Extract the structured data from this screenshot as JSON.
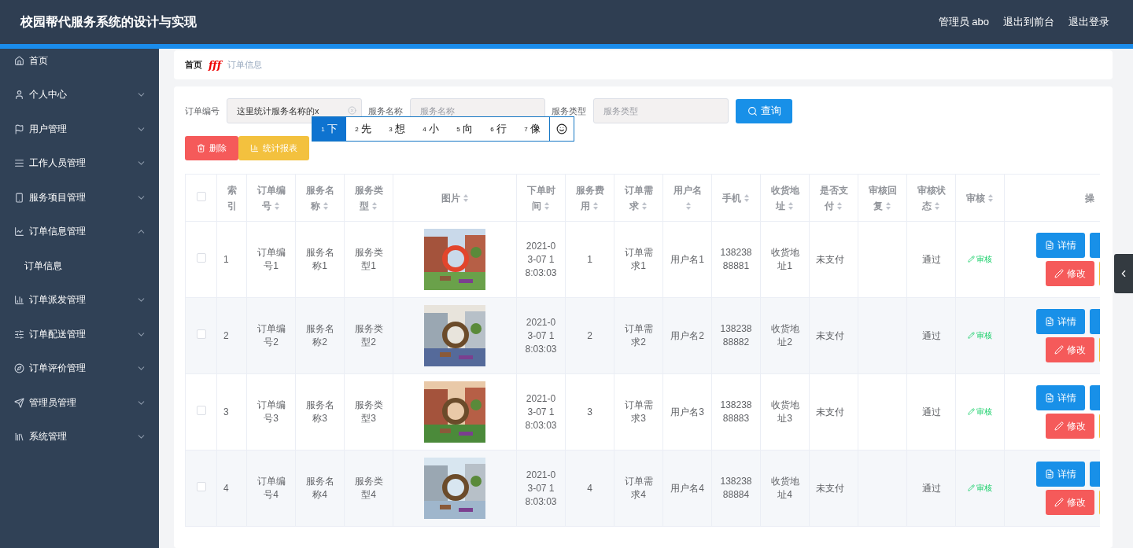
{
  "header": {
    "title": "校园帮代服务系统的设计与实现",
    "user": "管理员 abo",
    "links": [
      "退出到前台",
      "退出登录"
    ]
  },
  "sidebar": {
    "items": [
      {
        "label": "首页"
      },
      {
        "label": "个人中心",
        "expanded": false
      },
      {
        "label": "用户管理",
        "expanded": false
      },
      {
        "label": "工作人员管理",
        "expanded": false
      },
      {
        "label": "服务项目管理",
        "expanded": false
      },
      {
        "label": "订单信息管理",
        "expanded": true,
        "children": [
          {
            "label": "订单信息",
            "selected": true
          }
        ]
      },
      {
        "label": "订单派发管理",
        "expanded": false
      },
      {
        "label": "订单配送管理",
        "expanded": false
      },
      {
        "label": "订单评价管理",
        "expanded": false
      },
      {
        "label": "管理员管理",
        "expanded": false
      },
      {
        "label": "系统管理",
        "expanded": false
      }
    ]
  },
  "breadcrumb": {
    "home": "首页",
    "separator": "fff",
    "current": "订单信息"
  },
  "filters": [
    {
      "label": "订单编号",
      "value": "这里统计服务名称的x"
    },
    {
      "label": "服务名称",
      "placeholder": "服务名称"
    },
    {
      "label": "服务类型",
      "placeholder": "服务类型"
    }
  ],
  "search_button": "查询",
  "actions": [
    {
      "label": "删除",
      "kind": "danger"
    },
    {
      "label": "统计报表",
      "kind": "warning"
    }
  ],
  "ime": {
    "candidates": [
      {
        "number": "1",
        "char": "下",
        "selected": true
      },
      {
        "number": "2",
        "char": "先",
        "selected": false
      },
      {
        "number": "3",
        "char": "想",
        "selected": false
      },
      {
        "number": "4",
        "char": "小",
        "selected": false
      },
      {
        "number": "5",
        "char": "向",
        "selected": false
      },
      {
        "number": "6",
        "char": "行",
        "selected": false
      },
      {
        "number": "7",
        "char": "像",
        "selected": false
      }
    ]
  },
  "table": {
    "all_checked": false,
    "columns": [
      {
        "label": "索引",
        "kind": "text",
        "sortable": false
      },
      {
        "label": "订单编号",
        "kind": "text",
        "sortable": true
      },
      {
        "label": "服务名称",
        "kind": "text",
        "sortable": true
      },
      {
        "label": "服务类型",
        "kind": "text",
        "sortable": true
      },
      {
        "label": "图片",
        "kind": "picture",
        "sortable": true
      },
      {
        "label": "下单时间",
        "kind": "text",
        "sortable": true
      },
      {
        "label": "服务费用",
        "kind": "text",
        "sortable": true
      },
      {
        "label": "订单需求",
        "kind": "text",
        "sortable": true
      },
      {
        "label": "用户名",
        "kind": "text",
        "sortable": true
      },
      {
        "label": "手机",
        "kind": "text",
        "sortable": true
      },
      {
        "label": "收货地址",
        "kind": "text",
        "sortable": true
      },
      {
        "label": "是否支付",
        "kind": "text",
        "sortable": true
      },
      {
        "label": "审核回复",
        "kind": "text",
        "sortable": true
      },
      {
        "label": "审核状态",
        "kind": "text",
        "sortable": true
      },
      {
        "label": "审核",
        "kind": "link",
        "sortable": true
      },
      {
        "label": "操",
        "kind": "actions",
        "sortable": false
      }
    ],
    "rows": [
      {
        "checked": false,
        "cells": [
          "1",
          "订单编号1",
          "服务名称1",
          "服务类型1",
          "",
          "2021-03-07 18:03:03",
          "1",
          "订单需求1",
          "用户名1",
          "13823888881",
          "收货地址1",
          "未支付",
          "",
          "通过",
          "审核"
        ],
        "actions": [
          "详情",
          "修改"
        ]
      },
      {
        "checked": false,
        "cells": [
          "2",
          "订单编号2",
          "服务名称2",
          "服务类型2",
          "",
          "2021-03-07 18:03:03",
          "2",
          "订单需求2",
          "用户名2",
          "13823888882",
          "收货地址2",
          "未支付",
          "",
          "通过",
          "审核"
        ],
        "actions": [
          "详情",
          "修改"
        ]
      },
      {
        "checked": false,
        "cells": [
          "3",
          "订单编号3",
          "服务名称3",
          "服务类型3",
          "",
          "2021-03-07 18:03:03",
          "3",
          "订单需求3",
          "用户名3",
          "13823888883",
          "收货地址3",
          "未支付",
          "",
          "通过",
          "审核"
        ],
        "actions": [
          "详情",
          "修改"
        ]
      },
      {
        "checked": false,
        "cells": [
          "4",
          "订单编号4",
          "服务名称4",
          "服务类型4",
          "",
          "2021-03-07 18:03:03",
          "4",
          "订单需求4",
          "用户名4",
          "13823888884",
          "收货地址4",
          "未支付",
          "",
          "通过",
          "审核"
        ],
        "actions": [
          "详情",
          "修改"
        ]
      }
    ]
  }
}
